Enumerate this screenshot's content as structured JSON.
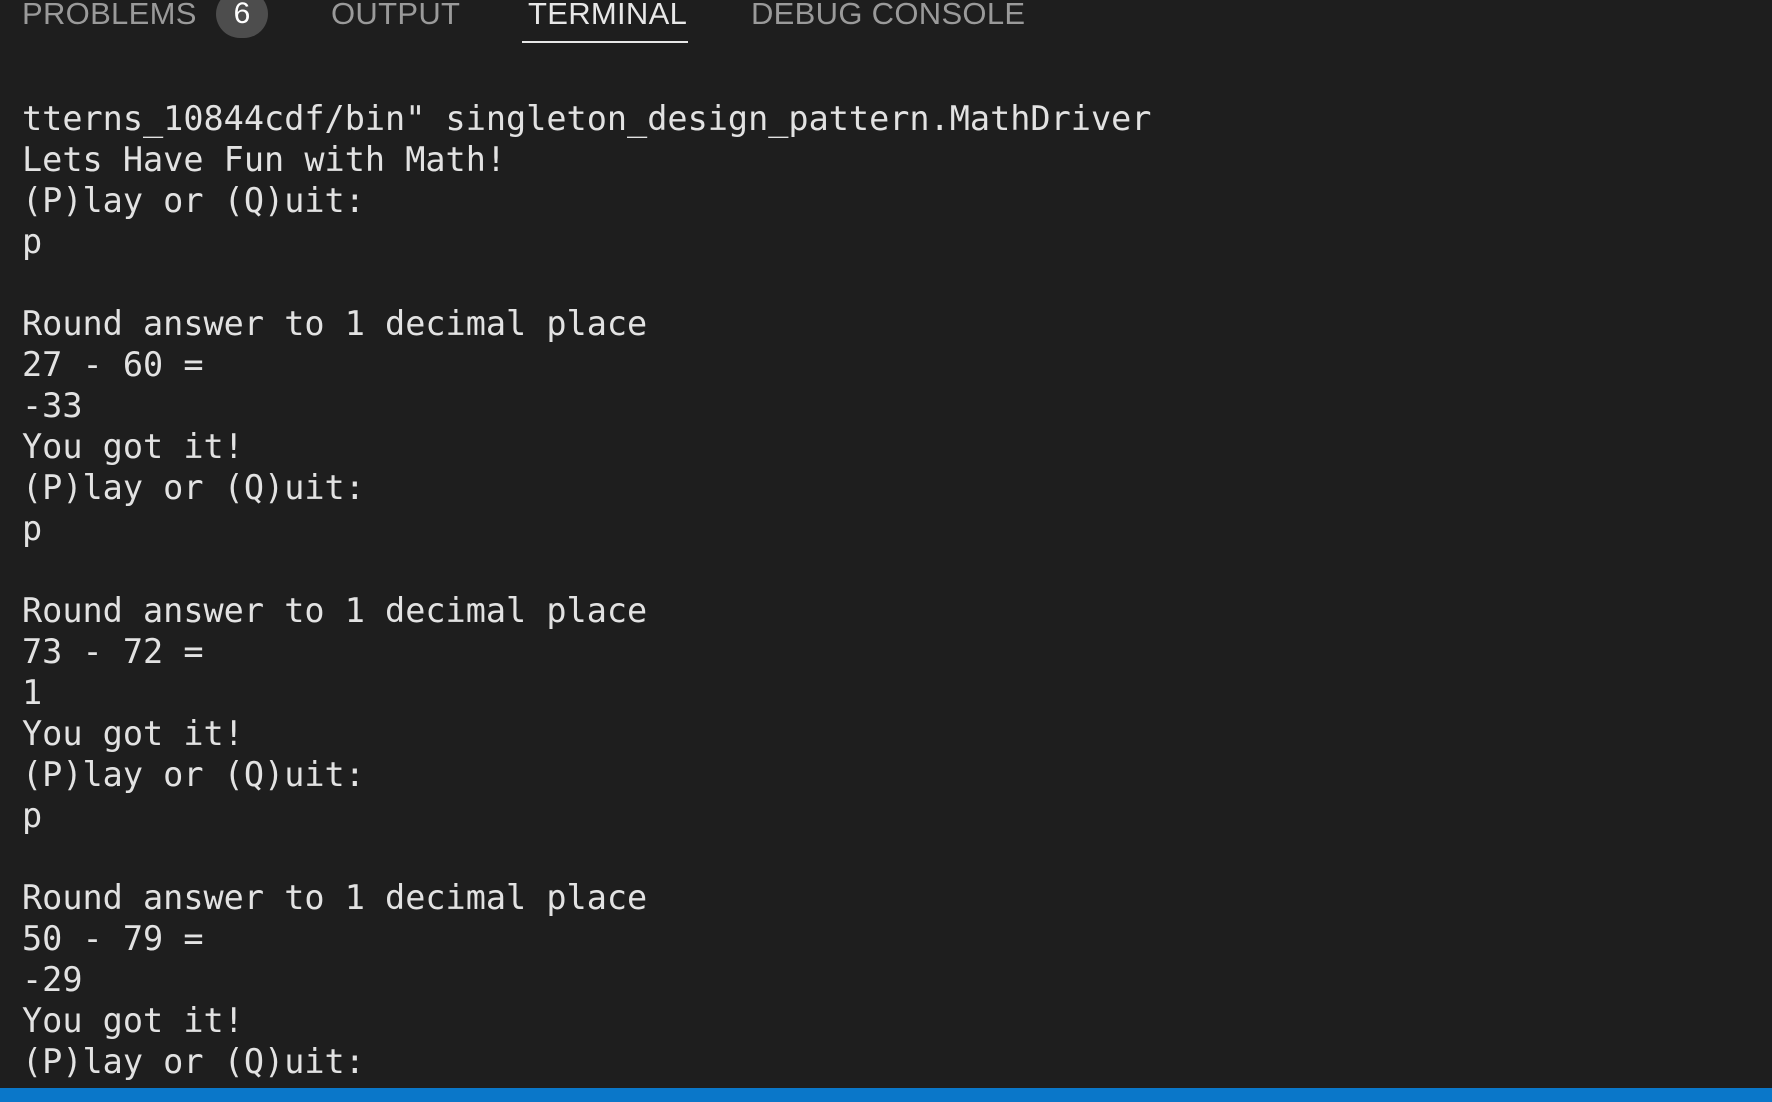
{
  "panel": {
    "tabs": {
      "problems": "PROBLEMS",
      "problems_count": "6",
      "output": "OUTPUT",
      "terminal": "TERMINAL",
      "debug_console": "DEBUG CONSOLE"
    },
    "active_tab": "TERMINAL"
  },
  "terminal": {
    "lines": [
      "tterns_10844cdf/bin\" singleton_design_pattern.MathDriver",
      "Lets Have Fun with Math!",
      "(P)lay or (Q)uit:",
      "p",
      "",
      "Round answer to 1 decimal place",
      "27 - 60 =",
      "-33",
      "You got it!",
      "(P)lay or (Q)uit:",
      "p",
      "",
      "Round answer to 1 decimal place",
      "73 - 72 =",
      "1",
      "You got it!",
      "(P)lay or (Q)uit:",
      "p",
      "",
      "Round answer to 1 decimal place",
      "50 - 79 =",
      "-29",
      "You got it!",
      "(P)lay or (Q)uit:"
    ]
  },
  "colors": {
    "background": "#1e1e1e",
    "text": "#e2e2e2",
    "inactive_tab": "#9a9a9a",
    "active_tab": "#e7e7e7",
    "badge_bg": "#4d4d4d",
    "statusbar": "#0a77c9"
  }
}
